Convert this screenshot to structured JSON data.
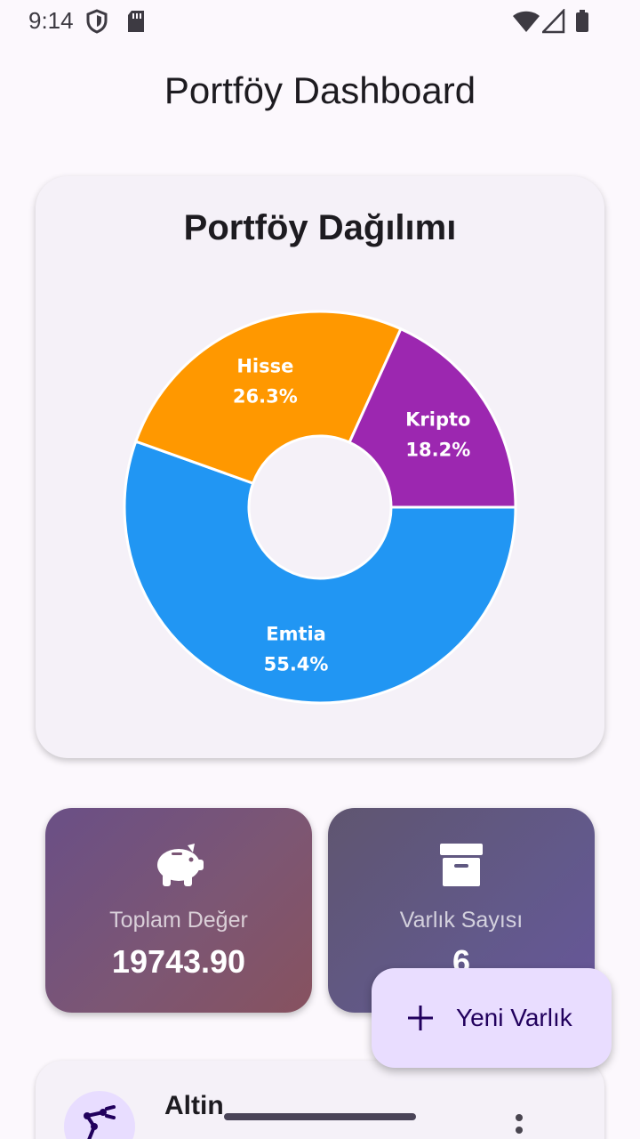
{
  "status_bar": {
    "time": "9:14",
    "icons": [
      "shield-icon",
      "sd-card-icon",
      "wifi-icon",
      "signal-icon",
      "battery-icon"
    ]
  },
  "app_bar": {
    "title": "Portföy Dashboard"
  },
  "chart_card": {
    "title": "Portföy Dağılımı",
    "chart_data": {
      "type": "pie",
      "title": "Portföy Dağılımı",
      "donut": true,
      "slices": [
        {
          "name": "Emtia",
          "value": 55.4,
          "label": "55.4%",
          "color": "#2196f3"
        },
        {
          "name": "Hisse",
          "value": 26.3,
          "label": "26.3%",
          "color": "#ff9800"
        },
        {
          "name": "Kripto",
          "value": 18.2,
          "label": "18.2%",
          "color": "#9c27b0"
        }
      ]
    }
  },
  "stats": {
    "total": {
      "icon": "piggy-bank-icon",
      "label": "Toplam Değer",
      "value": "19743.90"
    },
    "count": {
      "icon": "archive-box-icon",
      "label": "Varlık Sayısı",
      "value": "6"
    }
  },
  "asset_list": [
    {
      "icon": "precision-manufacturing-icon",
      "name": "Altin",
      "menu_icon": "more-vertical-icon"
    }
  ],
  "fab": {
    "icon": "plus-icon",
    "label": "Yeni Varlık"
  },
  "colors": {
    "accent": "#6750a4",
    "fab_bg": "#e9ddff",
    "background": "#fcf8fd"
  }
}
